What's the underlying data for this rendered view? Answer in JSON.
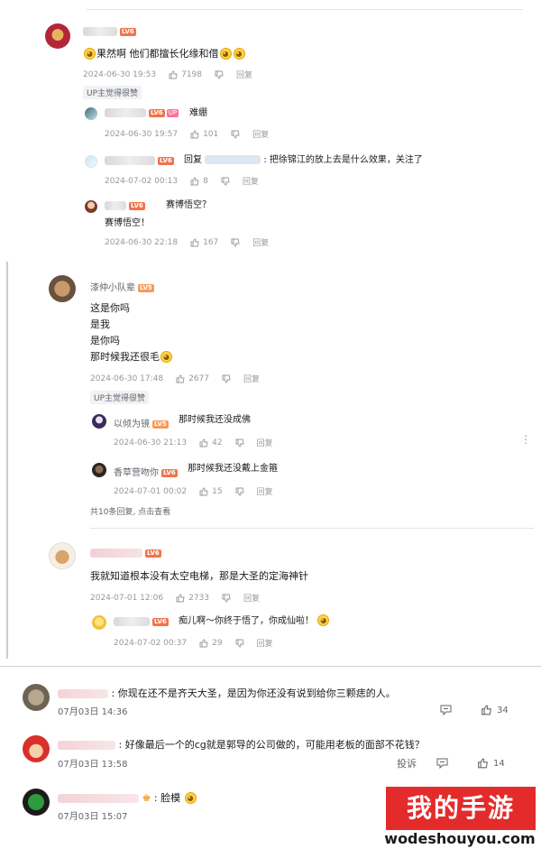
{
  "comments": [
    {
      "level": "LV6",
      "text": "果然啊 他们都擅长化缘和借",
      "date": "2024-06-30 19:53",
      "likes": "7198",
      "reply_label": "回复",
      "tag": "UP主觉得很赞",
      "replies": [
        {
          "level": "LV6",
          "up_badge": "UP",
          "text": "难绷",
          "date": "2024-06-30 19:57",
          "likes": "101",
          "reply_label": "回复"
        },
        {
          "level": "LV6",
          "prefix": "回复",
          "text": "把徐锦江的放上去是什么效果，关注了",
          "date": "2024-07-02 00:13",
          "likes": "8",
          "reply_label": "回复"
        },
        {
          "level": "LV6",
          "text": "赛博悟空？",
          "text2": "赛博悟空！",
          "date": "2024-06-30 22:18",
          "likes": "167",
          "reply_label": "回复"
        }
      ]
    },
    {
      "user": "漆仲小队辈",
      "level": "LV5",
      "lines": [
        "这是你吗",
        "是我",
        "是你吗",
        "那时候我还很毛"
      ],
      "date": "2024-06-30 17:48",
      "likes": "2677",
      "reply_label": "回复",
      "tag": "UP主觉得很赞",
      "replies": [
        {
          "user": "以倾为镜",
          "level": "LV5",
          "text": "那时候我还没成佛",
          "date": "2024-06-30 21:13",
          "likes": "42",
          "reply_label": "回复"
        },
        {
          "user": "香草营吻你",
          "level": "LV6",
          "text": "那时候我还没戴上金箍",
          "date": "2024-07-01 00:02",
          "likes": "15",
          "reply_label": "回复"
        }
      ],
      "more": "共10条回复, 点击查看"
    },
    {
      "level": "LV6",
      "text": "我就知道根本没有太空电梯，那是大圣的定海神针",
      "date": "2024-07-01 12:06",
      "likes": "2733",
      "reply_label": "回复",
      "replies": [
        {
          "level": "LV6",
          "text": "痴儿啊～你终于悟了，你成仙啦！",
          "date": "2024-07-02 00:37",
          "likes": "29",
          "reply_label": "回复"
        }
      ]
    }
  ],
  "bottom_comments": [
    {
      "text": "你现在还不是齐天大圣，是因为你还没有说到给你三颗痣的人。",
      "date": "07月03日 14:36",
      "likes": "34"
    },
    {
      "text": "好像最后一个的cg就是郭导的公司做的，可能用老板的面部不花钱？",
      "date": "07月03日 13:58",
      "likes": "14",
      "report": "投诉"
    },
    {
      "text": "脸模",
      "date": "07月03日 15:07"
    }
  ],
  "watermark": {
    "title": "我的手游",
    "url": "wodeshouyou.com"
  },
  "colors": {
    "accent": "#fb7299",
    "level": "#f3734a",
    "watermark_bg": "#e32b2b"
  }
}
